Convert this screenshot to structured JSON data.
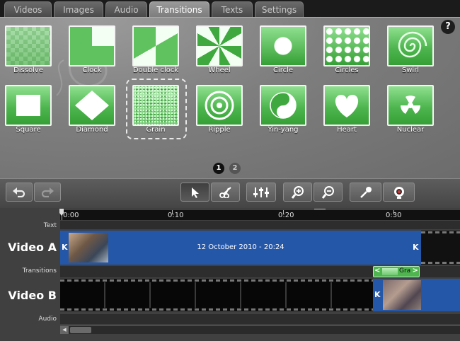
{
  "tabs": [
    {
      "label": "Videos",
      "active": false
    },
    {
      "label": "Images",
      "active": false
    },
    {
      "label": "Audio",
      "active": false
    },
    {
      "label": "Transitions",
      "active": true
    },
    {
      "label": "Texts",
      "active": false
    },
    {
      "label": "Settings",
      "active": false
    }
  ],
  "help_label": "?",
  "transitions": [
    {
      "label": "Dissolve",
      "icon": "dissolve-icon"
    },
    {
      "label": "Clock",
      "icon": "clock-icon"
    },
    {
      "label": "Double clock",
      "icon": "double-clock-icon"
    },
    {
      "label": "Wheel",
      "icon": "wheel-icon"
    },
    {
      "label": "Circle",
      "icon": "circle-icon"
    },
    {
      "label": "Circles",
      "icon": "circles-icon"
    },
    {
      "label": "Swirl",
      "icon": "swirl-icon"
    },
    {
      "label": "Square",
      "icon": "square-icon"
    },
    {
      "label": "Diamond",
      "icon": "diamond-icon"
    },
    {
      "label": "Grain",
      "icon": "grain-icon",
      "selected": true
    },
    {
      "label": "Ripple",
      "icon": "ripple-icon"
    },
    {
      "label": "Yin-yang",
      "icon": "yin-yang-icon"
    },
    {
      "label": "Heart",
      "icon": "heart-icon"
    },
    {
      "label": "Nuclear",
      "icon": "nuclear-icon"
    }
  ],
  "pages": [
    {
      "label": "1",
      "active": true
    },
    {
      "label": "2",
      "active": false
    }
  ],
  "toolbar": [
    "undo-icon",
    "redo-icon",
    "select-pointer-icon",
    "cut-scissors-icon",
    "mixer-sliders-icon",
    "zoom-in-icon",
    "zoom-out-icon",
    "microphone-icon",
    "webcam-icon"
  ],
  "ruler_labels": [
    "0:00",
    "0:10",
    "0:20",
    "0:30"
  ],
  "tracks": {
    "text": "Text",
    "video_a": "Video A",
    "transitions": "Transitions",
    "video_b": "Video B",
    "audio": "Audio"
  },
  "clip_a_label": "12 October 2010 - 20:24",
  "transition_clip_label": "Gra",
  "colors": {
    "accent_green": "#4fb64f",
    "clip_blue": "#2557a8"
  }
}
